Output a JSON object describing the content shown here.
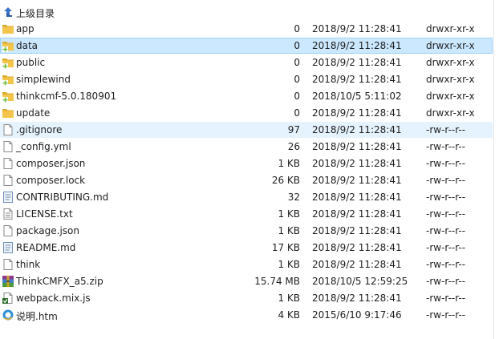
{
  "parent": {
    "label": "上级目录",
    "icon": "up-arrow-icon"
  },
  "colors": {
    "folder": "#f3c54a",
    "folder_dark": "#dcaa2c",
    "badge": "#6fbf3b",
    "hover": "#e5f3ff",
    "selected": "#cce8ff",
    "selected_border": "#99d1ff"
  },
  "files": [
    {
      "name": "app",
      "size": "0",
      "date": "2018/9/2 11:28:41",
      "perms": "drwxr-xr-x",
      "icon": "folder-icon"
    },
    {
      "name": "data",
      "size": "0",
      "date": "2018/9/2 11:28:41",
      "perms": "drwxr-xr-x",
      "icon": "folder-badged-icon",
      "state": "selected"
    },
    {
      "name": "public",
      "size": "0",
      "date": "2018/9/2 11:28:41",
      "perms": "drwxr-xr-x",
      "icon": "folder-badged-icon"
    },
    {
      "name": "simplewind",
      "size": "0",
      "date": "2018/9/2 11:28:41",
      "perms": "drwxr-xr-x",
      "icon": "folder-badged-icon"
    },
    {
      "name": "thinkcmf-5.0.180901",
      "size": "0",
      "date": "2018/10/5 5:11:02",
      "perms": "drwxr-xr-x",
      "icon": "folder-badged-icon"
    },
    {
      "name": "update",
      "size": "0",
      "date": "2018/9/2 11:28:41",
      "perms": "drwxr-xr-x",
      "icon": "folder-icon"
    },
    {
      "name": ".gitignore",
      "size": "97",
      "date": "2018/9/2 11:28:41",
      "perms": "-rw-r--r--",
      "icon": "file-icon",
      "state": "hover"
    },
    {
      "name": "_config.yml",
      "size": "26",
      "date": "2018/9/2 11:28:41",
      "perms": "-rw-r--r--",
      "icon": "file-icon"
    },
    {
      "name": "composer.json",
      "size": "1 KB",
      "date": "2018/9/2 11:28:41",
      "perms": "-rw-r--r--",
      "icon": "file-icon"
    },
    {
      "name": "composer.lock",
      "size": "26 KB",
      "date": "2018/9/2 11:28:41",
      "perms": "-rw-r--r--",
      "icon": "file-icon"
    },
    {
      "name": "CONTRIBUTING.md",
      "size": "32",
      "date": "2018/9/2 11:28:41",
      "perms": "-rw-r--r--",
      "icon": "markdown-file-icon"
    },
    {
      "name": "LICENSE.txt",
      "size": "1 KB",
      "date": "2018/9/2 11:28:41",
      "perms": "-rw-r--r--",
      "icon": "text-file-icon"
    },
    {
      "name": "package.json",
      "size": "1 KB",
      "date": "2018/9/2 11:28:41",
      "perms": "-rw-r--r--",
      "icon": "file-icon"
    },
    {
      "name": "README.md",
      "size": "17 KB",
      "date": "2018/9/2 11:28:41",
      "perms": "-rw-r--r--",
      "icon": "markdown-file-icon"
    },
    {
      "name": "think",
      "size": "1 KB",
      "date": "2018/9/2 11:28:41",
      "perms": "-rw-r--r--",
      "icon": "file-icon"
    },
    {
      "name": "ThinkCMFX_a5.zip",
      "size": "15.74 MB",
      "date": "2018/10/5 12:59:25",
      "perms": "-rw-r--r--",
      "icon": "archive-icon"
    },
    {
      "name": "webpack.mix.js",
      "size": "1 KB",
      "date": "2018/9/2 11:28:41",
      "perms": "-rw-r--r--",
      "icon": "script-file-icon"
    },
    {
      "name": "说明.htm",
      "size": "4 KB",
      "date": "2015/6/10 9:17:46",
      "perms": "-rw-r--r--",
      "icon": "browser-file-icon"
    }
  ]
}
